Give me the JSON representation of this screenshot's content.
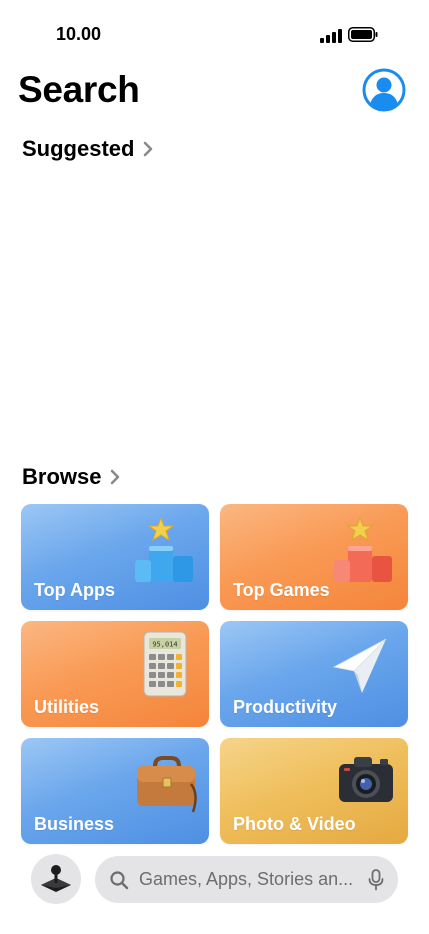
{
  "status_bar": {
    "time": "10.00"
  },
  "header": {
    "title": "Search"
  },
  "suggested": {
    "label": "Suggested"
  },
  "browse": {
    "label": "Browse",
    "categories": [
      {
        "label": "Top Apps",
        "color": "#6aa6ec",
        "icon": "podium-star-blue-icon"
      },
      {
        "label": "Top Games",
        "color": "#f99a55",
        "icon": "podium-star-red-icon"
      },
      {
        "label": "Utilities",
        "color": "#f99a55",
        "icon": "calculator-icon",
        "icon_text": "95,014"
      },
      {
        "label": "Productivity",
        "color": "#6aa6ec",
        "icon": "paper-plane-icon"
      },
      {
        "label": "Business",
        "color": "#6aa6ec",
        "icon": "briefcase-icon"
      },
      {
        "label": "Photo & Video",
        "color": "#efbf5d",
        "icon": "camera-icon"
      }
    ]
  },
  "bottom": {
    "search_placeholder": "Games, Apps, Stories an..."
  }
}
